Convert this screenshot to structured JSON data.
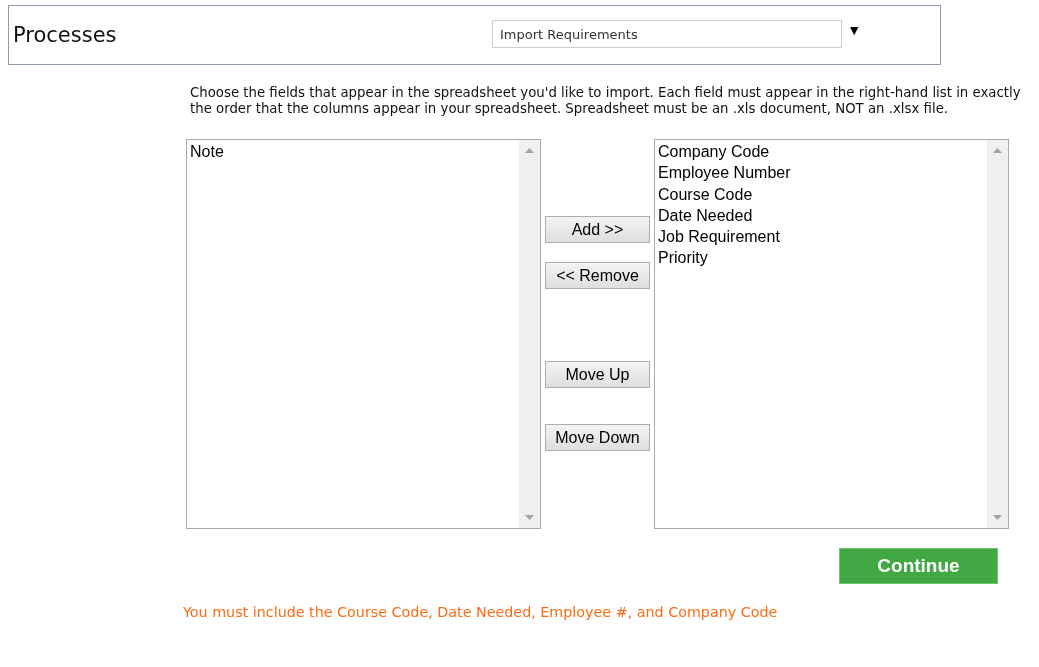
{
  "header": {
    "title": "Processes",
    "select": {
      "value": "Import Requirements",
      "arrow": "▼"
    }
  },
  "instructions": "Choose the fields that appear in the spreadsheet you'd like to import. Each field must appear in the right-hand list in exactly the order that the columns appear in your spreadsheet. Spreadsheet must be an .xls document, NOT an .xlsx file.",
  "available_fields": [
    "Note"
  ],
  "selected_fields": [
    "Company Code",
    "Employee Number",
    "Course Code",
    "Date Needed",
    "Job Requirement",
    "Priority"
  ],
  "buttons": [
    {
      "kind": "add",
      "label": "Add >>"
    },
    {
      "kind": "remove",
      "label": "<< Remove"
    },
    {
      "kind": "up",
      "label": "Move Up"
    },
    {
      "kind": "down",
      "label": "Move Down"
    }
  ],
  "continue": "Continue",
  "error": "You must include the Course Code, Date Needed, Employee #, and Company Code"
}
